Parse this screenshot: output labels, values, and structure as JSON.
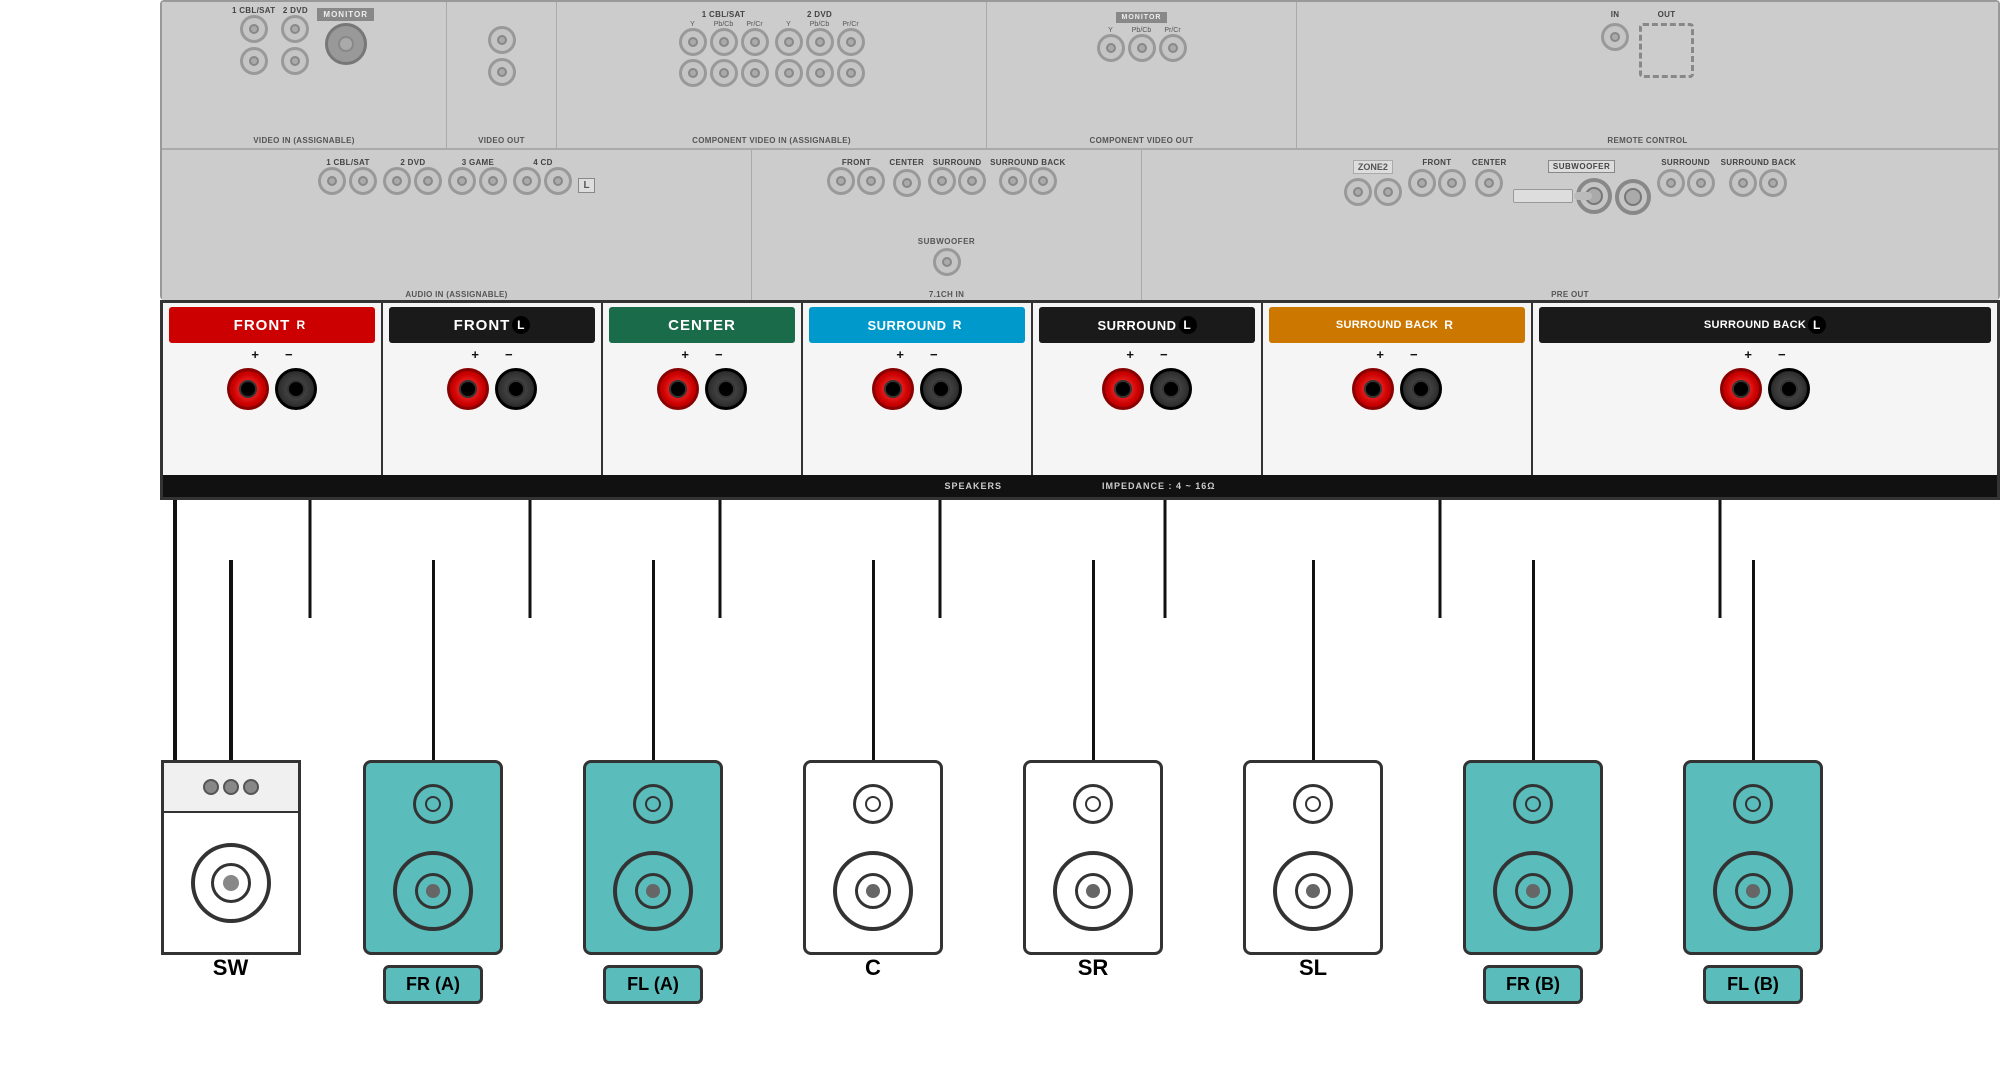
{
  "receiver": {
    "video_in_label": "VIDEO IN (ASSIGNABLE)",
    "video_out_label": "VIDEO OUT",
    "comp_video_in_label": "COMPONENT VIDEO IN (ASSIGNABLE)",
    "comp_video_out_label": "COMPONENT VIDEO OUT",
    "remote_control_label": "REMOTE CONTROL",
    "monitor_label": "MONITOR",
    "audio_in_label": "AUDIO IN (ASSIGNABLE)",
    "ch71_label": "7.1CH IN",
    "preout_label": "PRE OUT",
    "subwoofer_label": "SUBWOOFER",
    "zone2_label": "ZONE2",
    "speakers_label": "SPEAKERS",
    "impedance_label": "IMPEDANCE : 4 ~ 16Ω",
    "in_label": "IN",
    "out_label": "OUT"
  },
  "terminal_groups": [
    {
      "id": "front-r",
      "label": "FRONT",
      "letter": "R",
      "type": "colored-red"
    },
    {
      "id": "front-l",
      "label": "FRONT",
      "letter": "L",
      "type": "colored-black"
    },
    {
      "id": "center",
      "label": "CENTER",
      "type": "colored-green"
    },
    {
      "id": "surround-r",
      "label": "SURROUND",
      "letter": "R",
      "type": "colored-teal"
    },
    {
      "id": "surround-l",
      "label": "SURROUND",
      "letter": "L",
      "type": "colored-black2"
    },
    {
      "id": "sb-r",
      "label": "SURROUND BACK",
      "letter": "R",
      "type": "colored-orange"
    },
    {
      "id": "sb-l",
      "label": "SURROUND BACK",
      "letter": "L",
      "type": "colored-black3"
    }
  ],
  "speakers": [
    {
      "id": "sw",
      "label": "SW",
      "type": "subwoofer",
      "color": "white"
    },
    {
      "id": "fr-a",
      "label": "FR (A)",
      "type": "bookshelf",
      "color": "teal"
    },
    {
      "id": "fl-a",
      "label": "FL (A)",
      "type": "bookshelf",
      "color": "teal"
    },
    {
      "id": "c",
      "label": "C",
      "type": "bookshelf",
      "color": "white"
    },
    {
      "id": "sr",
      "label": "SR",
      "type": "bookshelf",
      "color": "white"
    },
    {
      "id": "sl",
      "label": "SL",
      "type": "bookshelf",
      "color": "white"
    },
    {
      "id": "fr-b",
      "label": "FR (B)",
      "type": "bookshelf",
      "color": "teal"
    },
    {
      "id": "fl-b",
      "label": "FL (B)",
      "type": "bookshelf",
      "color": "teal"
    }
  ],
  "video_top_labels": {
    "cbl_sat_1": "1 CBL/SAT",
    "dvd_2": "2 DVD",
    "y1": "Y",
    "pbcb1": "Pb/Cb",
    "prcr1": "Pr/Cr",
    "y2": "Y",
    "pbcb2": "Pb/Cb",
    "prcr2": "Pr/Cr",
    "y3": "Y",
    "pbcb3": "Pb/Cb",
    "prcr3": "Pr/Cr"
  },
  "audio_bottom_labels": {
    "cbl_sat": "1 CBL/SAT",
    "dvd": "2 DVD",
    "game": "3 GAME",
    "cd": "4 CD",
    "front": "FRONT",
    "center": "CENTER",
    "surround": "SURROUND",
    "surround_back": "SURROUND BACK",
    "subwoofer": "SUBWOOFER"
  }
}
